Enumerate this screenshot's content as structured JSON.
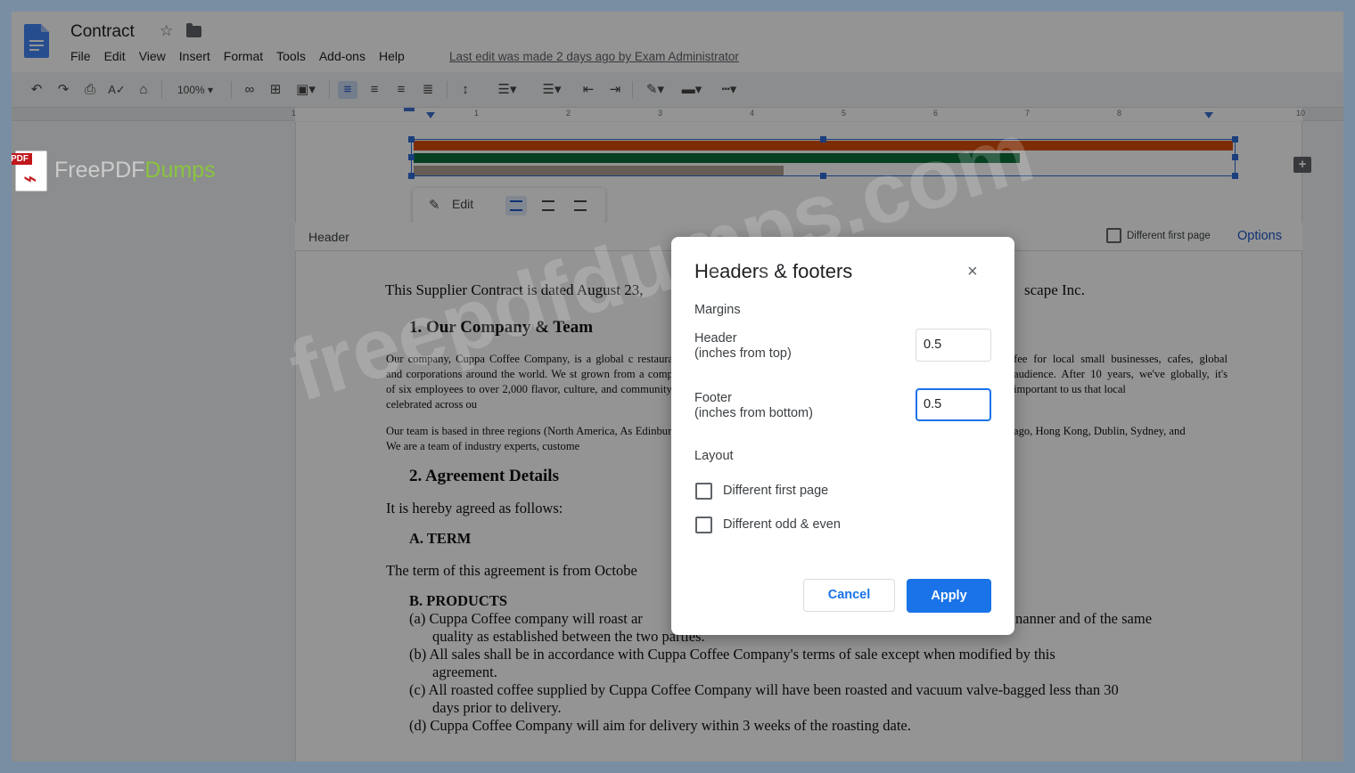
{
  "document": {
    "title": "Contract"
  },
  "menu": [
    "File",
    "Edit",
    "View",
    "Insert",
    "Format",
    "Tools",
    "Add-ons",
    "Help"
  ],
  "last_edit": "Last edit was made 2 days ago by Exam Administrator",
  "toolbar": {
    "zoom": "100%"
  },
  "ruler": {
    "numbers": [
      "1",
      "1",
      "2",
      "3",
      "4",
      "5",
      "6",
      "7",
      "8",
      "10"
    ]
  },
  "image_toolbar": {
    "edit_label": "Edit"
  },
  "header_bar": {
    "label": "Header",
    "different_first_page": "Different first page",
    "options": "Options"
  },
  "doc": {
    "intro": "This Supplier Contract is dated August 23,",
    "intro_end": "scape Inc.",
    "h1": "1. Our Company & Team",
    "p1": "Our company, Cuppa Coffee Company, is a global c restaurants, and corporations around the world. We st grown from a company of six employees to over 2,000 flavor, culture, and community are celebrated across ou",
    "p1_right": "fee for local small businesses, cafes, global audience. After 10 years, we've globally, it's important to us that local",
    "p2": "Our team is based in three regions (North America, As Edinburgh). We are a team of industry experts, custome",
    "p2_right": "ago, Hong Kong, Dublin, Sydney, and",
    "h2": "2. Agreement Details",
    "agreed": "It is hereby agreed as follows:",
    "term_h": "A. TERM",
    "term": "The term of this agreement is from Octobe",
    "products_h": "B. PRODUCTS",
    "pa1": "(a) Cuppa Coffee company will roast ar",
    "pa1_right": "nanner and of the same",
    "pa2": "quality as established between the two parties.",
    "pb1": "(b) All sales shall be in accordance with Cuppa Coffee Company's terms of sale except when modified by this",
    "pb2": "agreement.",
    "pc1": "(c) All roasted coffee supplied by Cuppa Coffee Company will have been roasted and vacuum valve-bagged less than 30",
    "pc2": "days prior to delivery.",
    "pd1": "(d) Cuppa Coffee Company will aim for delivery within 3 weeks of the roasting date."
  },
  "dialog": {
    "title": "Headers & footers",
    "close": "×",
    "margins_label": "Margins",
    "header_label_1": "Header",
    "header_label_2": "(inches from top)",
    "header_value": "0.5",
    "footer_label_1": "Footer",
    "footer_label_2": "(inches from bottom)",
    "footer_value": "0.5",
    "layout_label": "Layout",
    "opt_first_page": "Different first page",
    "opt_odd_even": "Different odd & even",
    "cancel": "Cancel",
    "apply": "Apply"
  },
  "watermark": {
    "pdf_tag": "PDF",
    "brand_free": "FreePDF",
    "brand_dumps": "Dumps",
    "overlay_text": "freepdfdumps.com"
  },
  "colors": {
    "accent": "#1a73e8",
    "stripe_orange": "#d84f0c",
    "stripe_green": "#0b6e3a",
    "stripe_tan": "#b0a395"
  },
  "icons": [
    "docs-logo-icon",
    "star-icon",
    "folder-icon",
    "undo-icon",
    "redo-icon",
    "print-icon",
    "spellcheck-icon",
    "paint-format-icon",
    "link-icon",
    "comment-icon",
    "image-icon",
    "align-left-icon",
    "align-center-icon",
    "align-right-icon",
    "justify-icon",
    "line-spacing-icon",
    "numbered-list-icon",
    "bulleted-list-icon",
    "indent-decrease-icon",
    "indent-increase-icon",
    "pen-icon",
    "close-icon",
    "add-comment-icon"
  ]
}
